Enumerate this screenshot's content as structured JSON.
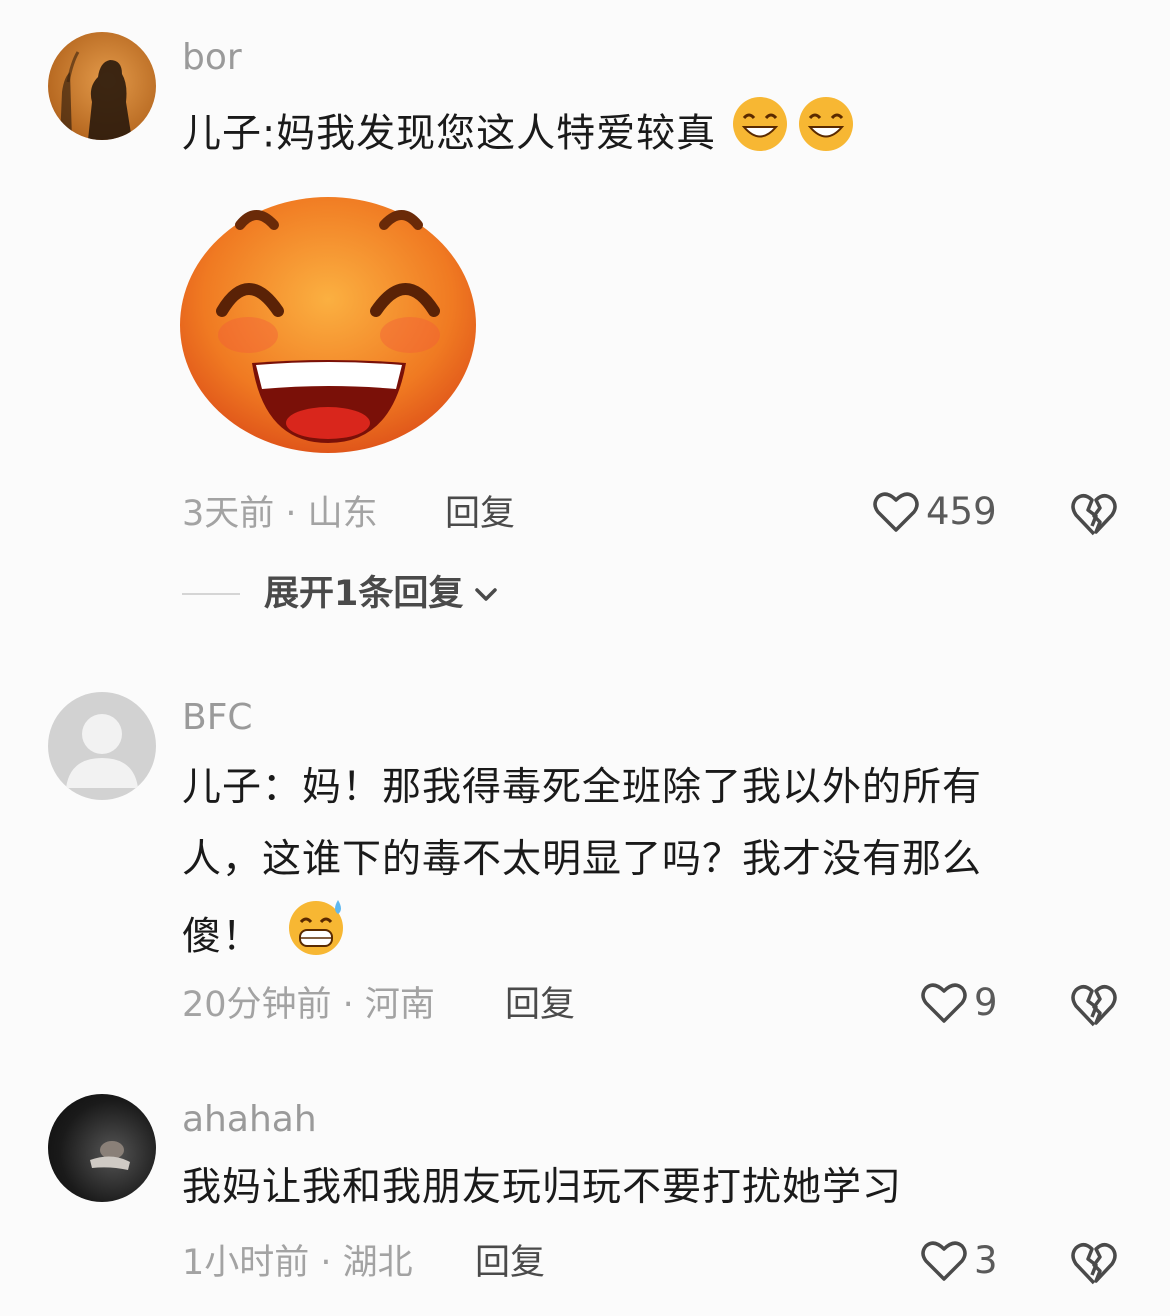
{
  "comments": [
    {
      "username": "bor",
      "text": "儿子:妈我发现您这人特爱较真",
      "time_location": "3天前 · 山东",
      "reply_label": "回复",
      "likes": "459",
      "emoji_after_text": [
        "grin-emoji",
        "grin-emoji"
      ],
      "sticker": "big-grin-sticker"
    },
    {
      "username": "BFC",
      "text_lines": [
        "儿子：妈！那我得毒死全班除了我以外的所有",
        "人，这谁下的毒不太明显了吗？我才没有那么",
        "傻！"
      ],
      "time_location": "20分钟前 · 河南",
      "reply_label": "回复",
      "likes": "9",
      "emoji_after_text": [
        "sweat-grin-emoji"
      ]
    },
    {
      "username": "ahahah",
      "text": "我妈让我和我朋友玩归玩不要打扰她学习",
      "time_location": "1小时前 · 湖北",
      "reply_label": "回复",
      "likes": "3"
    }
  ],
  "expand_replies": {
    "label": "展开1条回复"
  },
  "colors": {
    "background": "#fbfbfb",
    "username": "#9a9a9a",
    "meta": "#a3a3a3",
    "text": "#1a1a1a"
  }
}
